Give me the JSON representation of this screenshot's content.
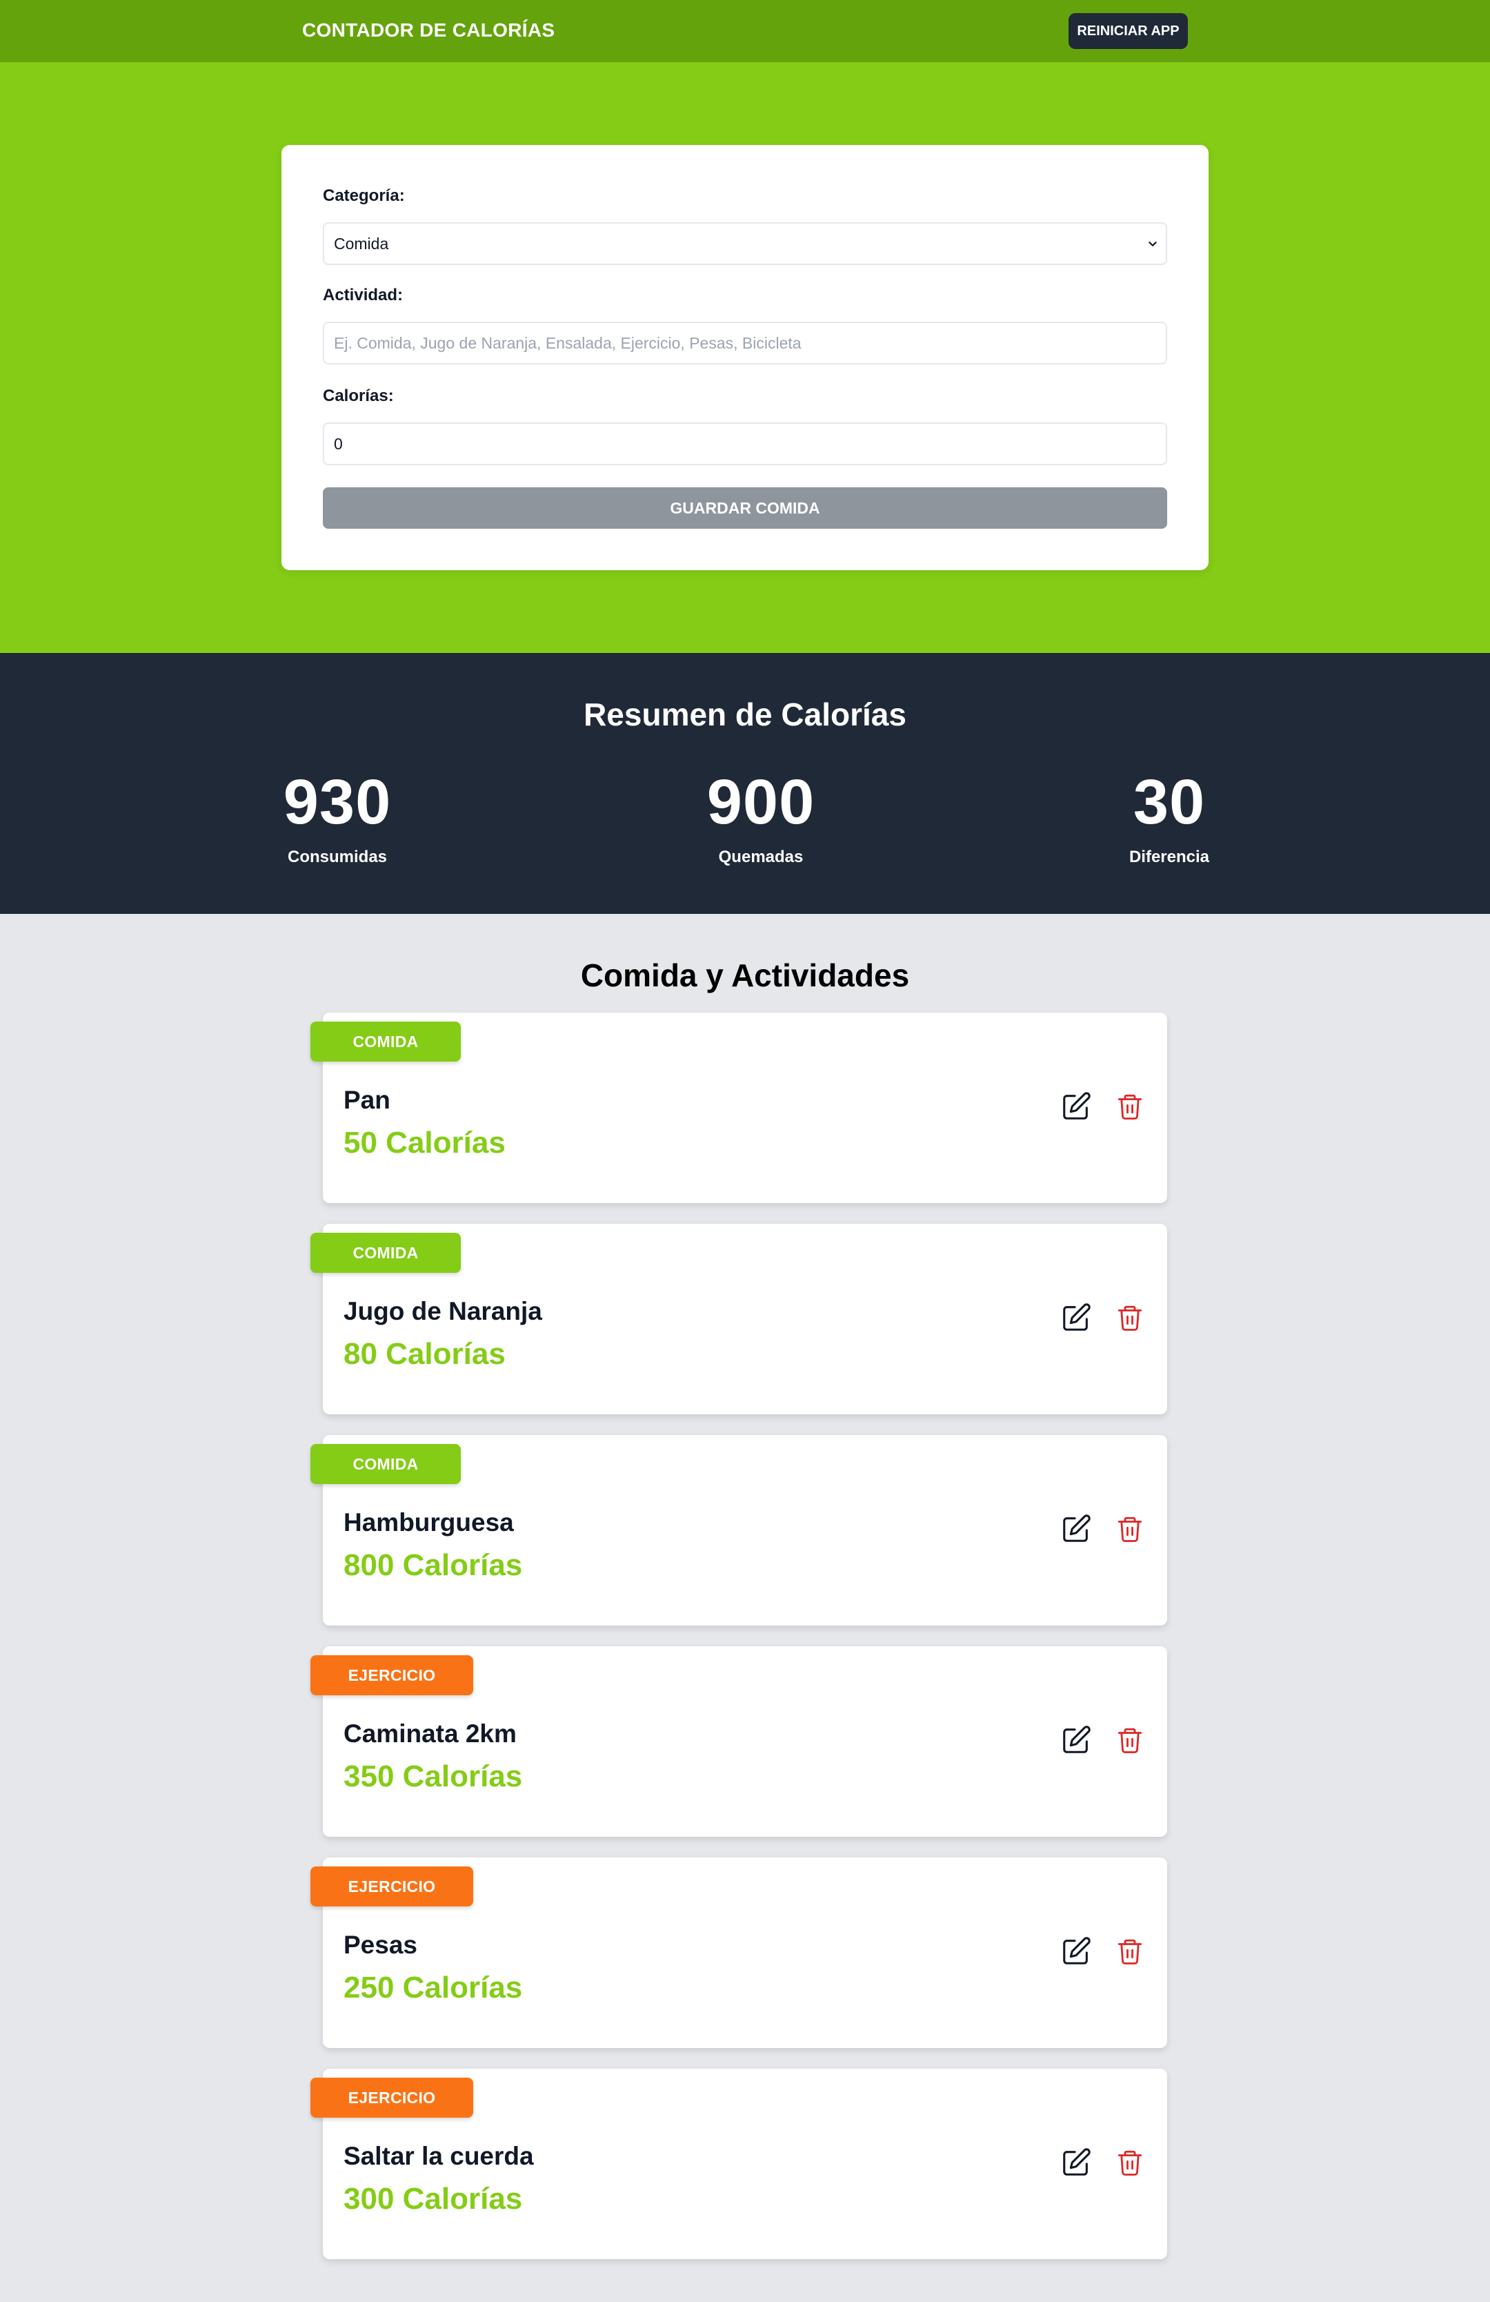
{
  "header": {
    "app_title": "CONTADOR DE CALORÍAS",
    "reset_label": "REINICIAR APP"
  },
  "form": {
    "category_label": "Categoría:",
    "category_value": "Comida",
    "activity_label": "Actividad:",
    "activity_placeholder": "Ej. Comida, Jugo de Naranja, Ensalada, Ejercicio, Pesas, Bicicleta",
    "calories_label": "Calorías:",
    "calories_value": "0",
    "submit_label": "GUARDAR COMIDA"
  },
  "summary": {
    "title": "Resumen de Calorías",
    "consumed_value": "930",
    "consumed_label": "Consumidas",
    "burned_value": "900",
    "burned_label": "Quemadas",
    "difference_value": "30",
    "difference_label": "Diferencia"
  },
  "list": {
    "title": "Comida y Actividades",
    "items": [
      {
        "category": "COMIDA",
        "name": "Pan",
        "calories": "50 Calorías"
      },
      {
        "category": "COMIDA",
        "name": "Jugo de Naranja",
        "calories": "80 Calorías"
      },
      {
        "category": "COMIDA",
        "name": "Hamburguesa",
        "calories": "800 Calorías"
      },
      {
        "category": "EJERCICIO",
        "name": "Caminata 2km",
        "calories": "350 Calorías"
      },
      {
        "category": "EJERCICIO",
        "name": "Pesas",
        "calories": "250 Calorías"
      },
      {
        "category": "EJERCICIO",
        "name": "Saltar la cuerda",
        "calories": "300 Calorías"
      }
    ]
  },
  "colors": {
    "topbar": "#65a30d",
    "hero": "#84cc16",
    "summary_bg": "#1f2937",
    "food_badge": "#84cc16",
    "exercise_badge": "#f97316",
    "calories_text": "#84cc16",
    "delete_icon": "#dc2626"
  },
  "icons": {
    "edit": "pencil-square-icon",
    "delete": "trash-icon",
    "select": "chevron-down-icon"
  }
}
